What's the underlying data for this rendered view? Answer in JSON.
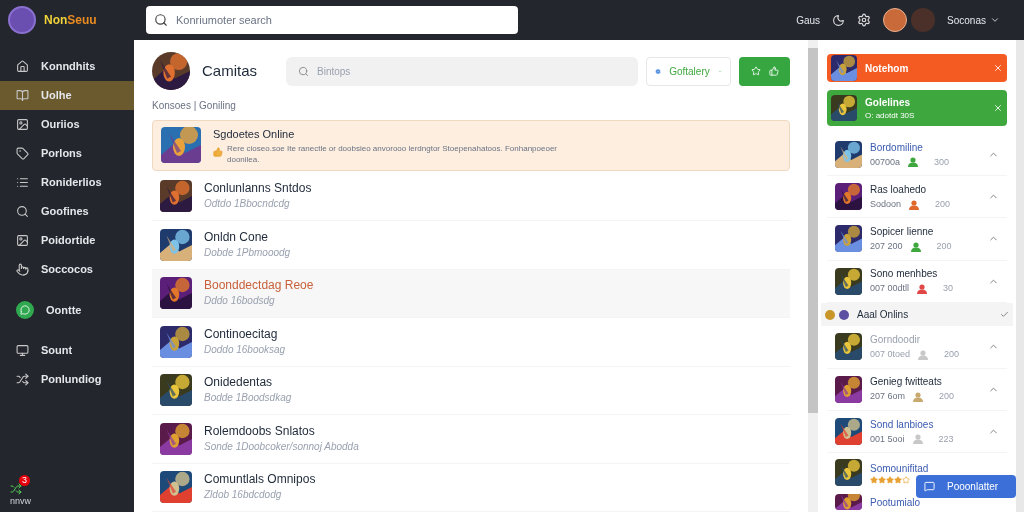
{
  "brand": {
    "name": "Non",
    "accent": "Seuu"
  },
  "top_search": {
    "placeholder": "Konriumoter search"
  },
  "top_bar": {
    "link": "Gaus",
    "user": "Soconas"
  },
  "sidebar": {
    "items": [
      {
        "label": "Konndhits",
        "selected": false,
        "kind": "link"
      },
      {
        "label": "Uolhe",
        "selected": true,
        "kind": "link"
      },
      {
        "label": "Ouriios",
        "selected": false,
        "kind": "link"
      },
      {
        "label": "Porlons",
        "selected": false,
        "kind": "link"
      },
      {
        "label": "Roniderlios",
        "selected": false,
        "kind": "link"
      },
      {
        "label": "Goofines",
        "selected": false,
        "kind": "link"
      },
      {
        "label": "Poidortide",
        "selected": false,
        "kind": "link"
      },
      {
        "label": "Soccocos",
        "selected": false,
        "kind": "link"
      },
      {
        "label": "Oontte",
        "selected": false,
        "kind": "status"
      },
      {
        "label": "Sount",
        "selected": false,
        "kind": "link"
      },
      {
        "label": "Ponlundiog",
        "selected": false,
        "kind": "link"
      }
    ],
    "footer": {
      "label": "nnvw",
      "count": "3"
    }
  },
  "header": {
    "title": "Camitas",
    "search_placeholder": "Bintops",
    "filter": "Goftalery",
    "breadcrumb": "Konsoes | Goniling"
  },
  "featured": {
    "title": "Sgdoetes Online",
    "description": "Rere cioseo.soe Ite ranectle or doobsieo anvorooo lerdngtor Stoepenahatoos. Fonhanpoeoer doonilea."
  },
  "rows": [
    {
      "title": "Conlunlanns Sntdos",
      "subtitle": "Odtdo 1Bbocndcdg",
      "selected": false
    },
    {
      "title": "Onldn Cone",
      "subtitle": "Dobde 1Pbmooodg",
      "selected": false
    },
    {
      "title": "Boonddectdag Reoe",
      "subtitle": "Dddo 16bodsdg",
      "selected": true
    },
    {
      "title": "Continoecitag",
      "subtitle": "Doddo 16booksag",
      "selected": false
    },
    {
      "title": "Onidedentas",
      "subtitle": "Bodde 1Boodsdkag",
      "selected": false
    },
    {
      "title": "Rolemdoobs Snlatos",
      "subtitle": "Sonde 1Doobcoker/sonnoj Abodda",
      "selected": false
    },
    {
      "title": "Comuntlals Omnipos",
      "subtitle": "Zldob 16bdcdodg",
      "selected": false
    }
  ],
  "notifications": [
    {
      "title": "Notehom",
      "color": "#f45b23"
    },
    {
      "title": "Golelines",
      "subtitle": "O: adotdt 30S",
      "color": "#3ea83f"
    }
  ],
  "feed": [
    {
      "title": "Bordomiline",
      "subtitle": "00700a",
      "count": "300",
      "unread": true,
      "color": "#3ea83f"
    },
    {
      "title": "Ras loahedo",
      "subtitle": "Sodoon",
      "count": "200",
      "unread": false,
      "color": "#e0682a"
    },
    {
      "title": "Sopicer lienne",
      "subtitle": "207 200",
      "count": "200",
      "unread": false,
      "color": "#3ea83f"
    },
    {
      "title": "Sono menhbes",
      "subtitle": "007 00dtll",
      "count": "30",
      "unread": false,
      "color": "#e04848"
    }
  ],
  "section": {
    "title": "Aaal Onlins"
  },
  "feed_more": [
    {
      "title": "Gorndoodir",
      "subtitle": "007 0toed",
      "count": "200",
      "unread": false,
      "faded": true,
      "color": "#c8c8c8"
    },
    {
      "title": "Genieg fwitteats",
      "subtitle": "207 6om",
      "count": "200",
      "unread": false,
      "faded": false,
      "color": "#c8aa70"
    },
    {
      "title": "Sond lanbioes",
      "subtitle": "001 5ooi",
      "count": "223",
      "unread": true,
      "faded": false,
      "color": "#c8c8c8"
    }
  ],
  "rated": {
    "title": "Somounifitad",
    "stars": 4
  },
  "last": {
    "title": "Pootumialo"
  },
  "float_button": {
    "label": "Pooonlatter"
  }
}
